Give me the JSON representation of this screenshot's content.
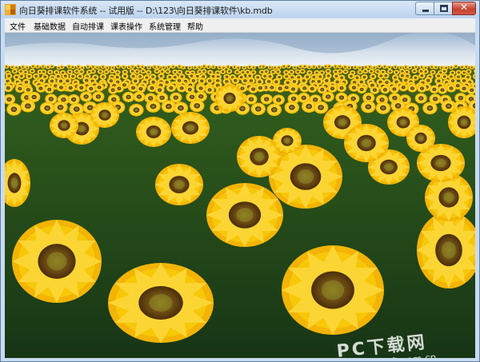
{
  "window": {
    "title": "向日葵排课软件系统 -- 试用版  -- D:\\123\\向日葵排课软件\\kb.mdb",
    "icon": "app-icon"
  },
  "controls": {
    "minimize_icon": "minimize-icon",
    "maximize_icon": "maximize-icon",
    "close_icon": "close-icon",
    "close_glyph": "✕"
  },
  "menu": [
    {
      "label": "文件"
    },
    {
      "label": "基础数据"
    },
    {
      "label": "自动排课"
    },
    {
      "label": "课表操作"
    },
    {
      "label": "系统管理"
    },
    {
      "label": "帮助"
    }
  ],
  "content": {
    "image": "sunflower-field-background",
    "watermark": {
      "brand": "PC下载网",
      "url": "www.pcsoft.com.cn"
    }
  },
  "colors": {
    "title_bar": "#c9dcf0",
    "close_button": "#c6432f",
    "sunflower_petal": "#f7c808",
    "sunflower_center": "#6b4a12"
  }
}
